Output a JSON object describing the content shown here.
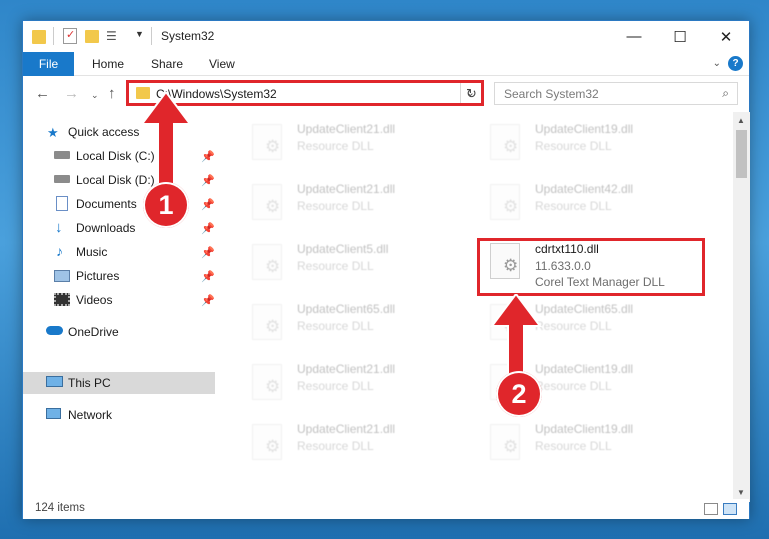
{
  "window": {
    "title": "System32"
  },
  "ribbon": {
    "file_label": "File",
    "tabs": [
      "Home",
      "Share",
      "View"
    ],
    "help_label": "?"
  },
  "nav": {
    "address": "C:\\Windows\\System32",
    "search_placeholder": "Search System32"
  },
  "sidebar": {
    "items": [
      {
        "label": "Quick access",
        "icon": "star-icon"
      },
      {
        "label": "Local Disk (C:)",
        "icon": "drive-icon",
        "pinned": true
      },
      {
        "label": "Local Disk (D:)",
        "icon": "drive-icon",
        "pinned": true
      },
      {
        "label": "Documents",
        "icon": "documents-icon",
        "pinned": true
      },
      {
        "label": "Downloads",
        "icon": "download-arrow-icon",
        "pinned": true
      },
      {
        "label": "Music",
        "icon": "music-note-icon",
        "pinned": true
      },
      {
        "label": "Pictures",
        "icon": "pictures-icon",
        "pinned": true
      },
      {
        "label": "Videos",
        "icon": "film-icon",
        "pinned": true
      },
      {
        "label": "OneDrive",
        "icon": "cloud-icon"
      },
      {
        "label": "This PC",
        "icon": "computer-icon",
        "selected": true
      },
      {
        "label": "Network",
        "icon": "network-icon"
      }
    ]
  },
  "files": [
    {
      "name": "UpdateClient21.dll",
      "desc": "Resource DLL"
    },
    {
      "name": "UpdateClient19.dll",
      "desc": "Resource DLL"
    },
    {
      "name": "UpdateClient21.dll",
      "desc": "Resource DLL"
    },
    {
      "name": "UpdateClient42.dll",
      "desc": "Resource DLL"
    },
    {
      "name": "UpdateClient5.dll",
      "desc": "Resource DLL"
    },
    {
      "name": "cdrtxt110.dll",
      "version": "11.633.0.0",
      "desc": "Corel Text Manager DLL",
      "highlighted": true
    },
    {
      "name": "UpdateClient65.dll",
      "desc": "Resource DLL"
    },
    {
      "name": "UpdateClient65.dll",
      "desc": "Resource DLL"
    },
    {
      "name": "UpdateClient21.dll",
      "desc": "Resource DLL"
    },
    {
      "name": "UpdateClient19.dll",
      "desc": "Resource DLL"
    },
    {
      "name": "UpdateClient21.dll",
      "desc": "Resource DLL"
    },
    {
      "name": "UpdateClient19.dll",
      "desc": "Resource DLL"
    }
  ],
  "status": {
    "item_count": "124 items"
  },
  "annotations": {
    "step1": "1",
    "step2": "2"
  },
  "colors": {
    "accent": "#1979ca",
    "highlight": "#e0262b"
  }
}
